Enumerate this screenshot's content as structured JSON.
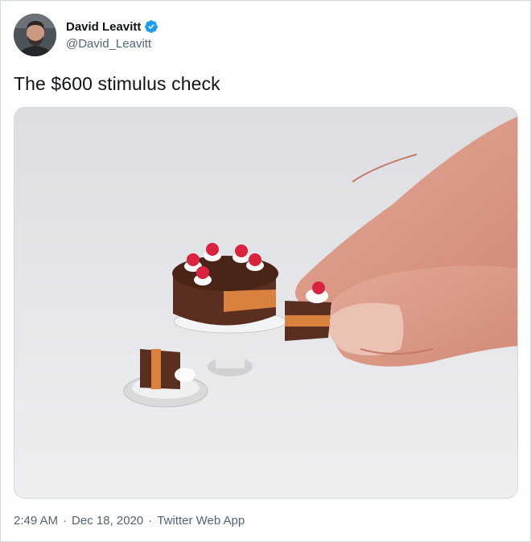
{
  "author": {
    "display_name": "David Leavitt",
    "handle": "@David_Leavitt",
    "verified": true,
    "avatar_icon": "avatar-photo"
  },
  "tweet": {
    "text": "The $600 stimulus check",
    "media_icon": "photo-miniature-cake"
  },
  "meta": {
    "time": "2:49 AM",
    "separator": "·",
    "date": "Dec 18, 2020",
    "source": "Twitter Web App"
  },
  "colors": {
    "verified_badge": "#1d9bf0",
    "text_primary": "#0f1419",
    "text_secondary": "#536471",
    "border": "#cfd9de"
  }
}
